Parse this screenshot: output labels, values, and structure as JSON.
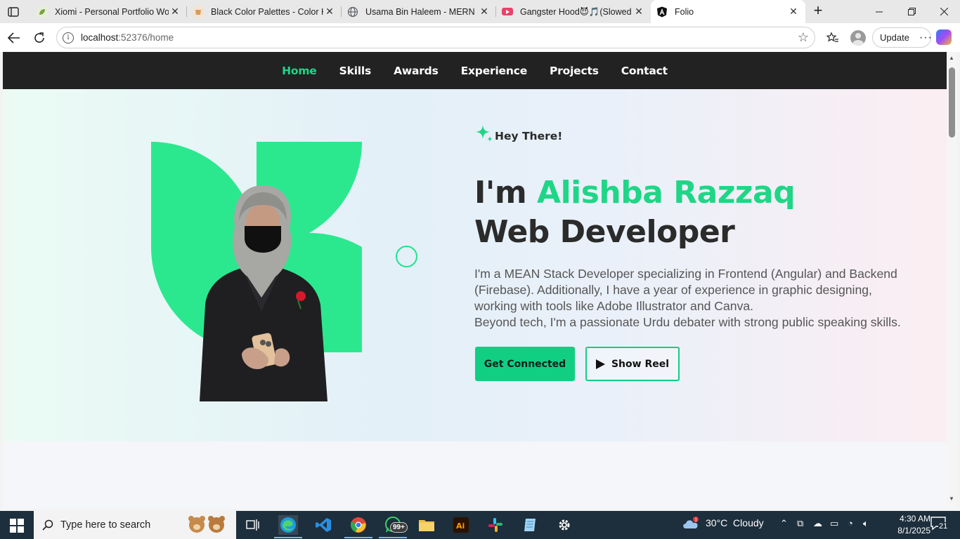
{
  "browser": {
    "tabs": [
      {
        "title": "Xiomi - Personal Portfolio Wor",
        "favicon_color": "#7ba23f",
        "favicon_glyph": "leaf-icon",
        "active": false
      },
      {
        "title": "Black Color Palettes - Color Hu",
        "favicon_color": "#d99a5b",
        "favicon_glyph": "cup-icon",
        "active": false
      },
      {
        "title": "Usama Bin Haleem - MERN St",
        "favicon_color": "#5f6368",
        "favicon_glyph": "globe-icon",
        "active": false
      },
      {
        "title": "Gangster Hood😈🎵(Slowed",
        "favicon_color": "#e8436a",
        "favicon_glyph": "youtube-icon",
        "active": false
      },
      {
        "title": "Folio",
        "favicon_color": "#111111",
        "favicon_glyph": "angular-icon",
        "active": true
      }
    ],
    "url_host": "localhost",
    "url_rest": ":52376/home",
    "update_label": "Update"
  },
  "site": {
    "nav": [
      {
        "label": "Home",
        "active": true
      },
      {
        "label": "Skills",
        "active": false
      },
      {
        "label": "Awards",
        "active": false
      },
      {
        "label": "Experience",
        "active": false
      },
      {
        "label": "Projects",
        "active": false
      },
      {
        "label": "Contact",
        "active": false
      }
    ],
    "hero": {
      "greeting": "Hey There!",
      "intro_prefix": "I'm ",
      "name": "Alishba Razzaq",
      "role": "Web Developer",
      "description_lines": [
        "I'm a MEAN Stack Developer specializing in Frontend (Angular) and Backend",
        "(Firebase). Additionally, I have a year of experience in graphic designing,",
        "working with tools like Adobe Illustrator and Canva.",
        "Beyond tech, I'm a passionate Urdu debater with strong public speaking skills."
      ],
      "primary_button": "Get Connected",
      "secondary_button": "Show Reel"
    },
    "colors": {
      "accent": "#1fd687",
      "nav_bg": "#222222",
      "text_dark": "#2b2b2b"
    }
  },
  "taskbar": {
    "search_placeholder": "Type here to search",
    "whatsapp_badge": "99+",
    "weather": "30°C  Cloudy",
    "weather_alert": "1",
    "time": "4:30 AM",
    "date": "8/1/2025",
    "notifications": "21"
  }
}
